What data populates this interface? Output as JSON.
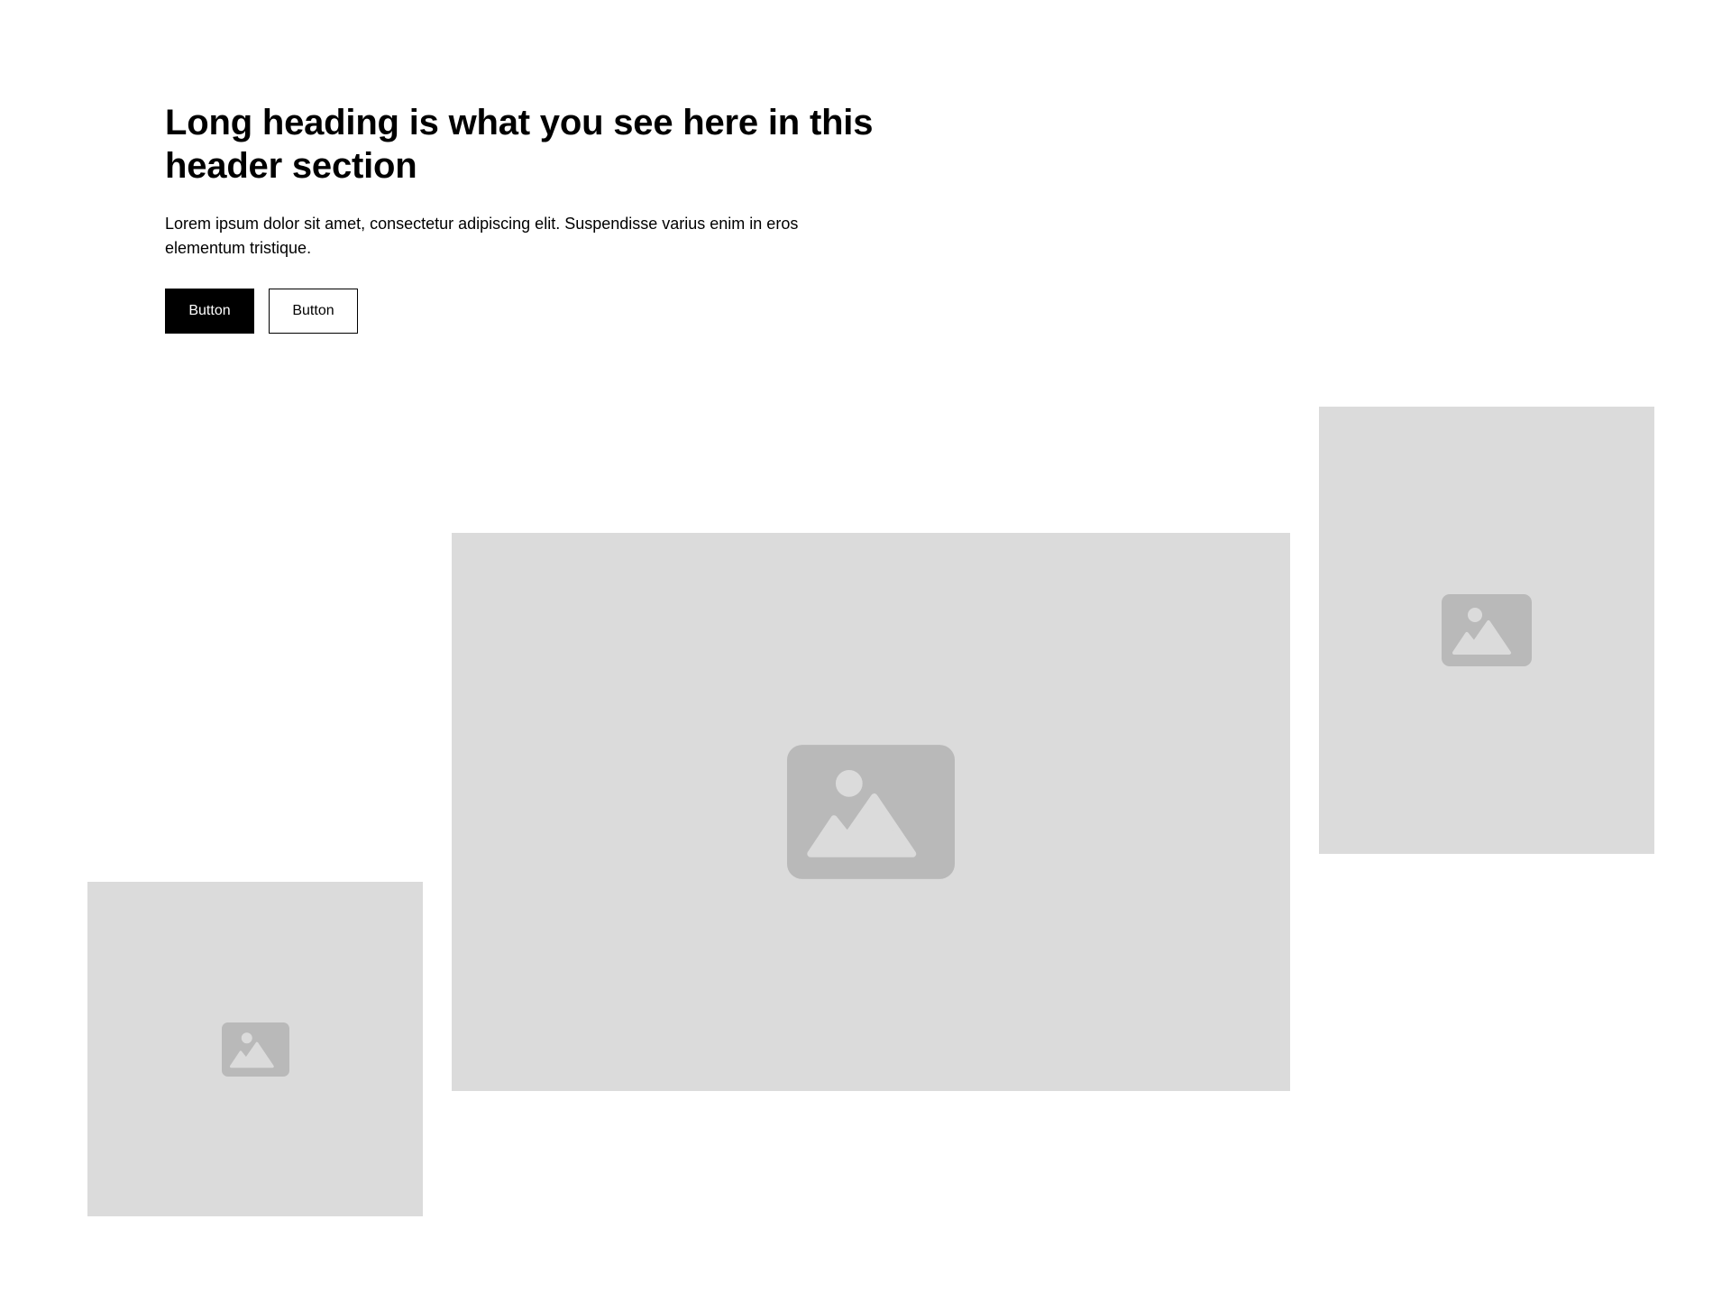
{
  "header": {
    "heading": "Long heading is what you see here in this header section",
    "body": "Lorem ipsum dolor sit amet, consectetur adipiscing elit. Suspendisse varius enim in eros elementum tristique.",
    "primary_button_label": "Button",
    "secondary_button_label": "Button"
  },
  "images": [
    {
      "icon": "image-placeholder-icon"
    },
    {
      "icon": "image-placeholder-icon"
    },
    {
      "icon": "image-placeholder-icon"
    }
  ],
  "colors": {
    "placeholder_bg": "#dbdbdb",
    "placeholder_icon": "#b9b9b9",
    "primary_button_bg": "#000000",
    "primary_button_text": "#ffffff"
  }
}
